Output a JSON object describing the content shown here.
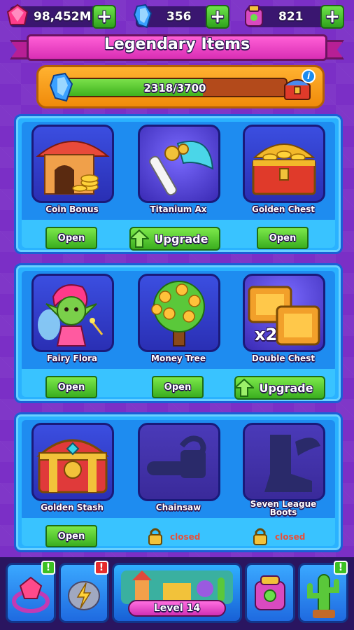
{
  "currencies": [
    {
      "icon": "gem-icon",
      "value": "98,452M"
    },
    {
      "icon": "crystal-icon",
      "value": "356"
    },
    {
      "icon": "potion-icon",
      "value": "821"
    }
  ],
  "plus_label": "+",
  "title": "Legendary Items",
  "progress": {
    "text": "2318/3700",
    "current": 2318,
    "max": 3700,
    "info_label": "i"
  },
  "sections": [
    {
      "items": [
        {
          "name": "Coin Bonus",
          "action": "open",
          "action_label": "Open",
          "icon": "coin-stall-icon"
        },
        {
          "name": "Titanium Ax",
          "action": "upgrade",
          "action_label": "Upgrade",
          "icon": "axe-icon"
        },
        {
          "name": "Golden Chest",
          "action": "open",
          "action_label": "Open",
          "icon": "gold-chest-icon"
        }
      ]
    },
    {
      "items": [
        {
          "name": "Fairy Flora",
          "action": "open",
          "action_label": "Open",
          "icon": "fairy-icon"
        },
        {
          "name": "Money Tree",
          "action": "open",
          "action_label": "Open",
          "icon": "money-tree-icon"
        },
        {
          "name": "Double Chest",
          "action": "upgrade",
          "action_label": "Upgrade",
          "icon": "double-chest-icon",
          "badge": "x2"
        }
      ]
    },
    {
      "items": [
        {
          "name": "Golden Stash",
          "action": "open",
          "action_label": "Open",
          "icon": "treasure-chest-icon"
        },
        {
          "name": "Chainsaw",
          "action": "closed",
          "action_label": "closed",
          "icon": "chainsaw-icon"
        },
        {
          "name": "Seven League Boots",
          "action": "closed",
          "action_label": "closed",
          "icon": "winged-boot-icon"
        }
      ]
    }
  ],
  "nav": {
    "items": [
      {
        "icon": "gem-ring-icon",
        "badge": "!",
        "badge_color": "green"
      },
      {
        "icon": "lightning-stone-icon",
        "badge": "!",
        "badge_color": "red"
      },
      {
        "icon": "village-icon",
        "label": "Level 14"
      },
      {
        "icon": "backpack-icon"
      },
      {
        "icon": "cactus-icon",
        "badge": "!",
        "badge_color": "green"
      }
    ]
  },
  "colors": {
    "accent_green": "#3aae1f",
    "banner_pink": "#d92fb4",
    "panel_blue": "#2ab2ff",
    "closed_red": "#e8503a"
  }
}
